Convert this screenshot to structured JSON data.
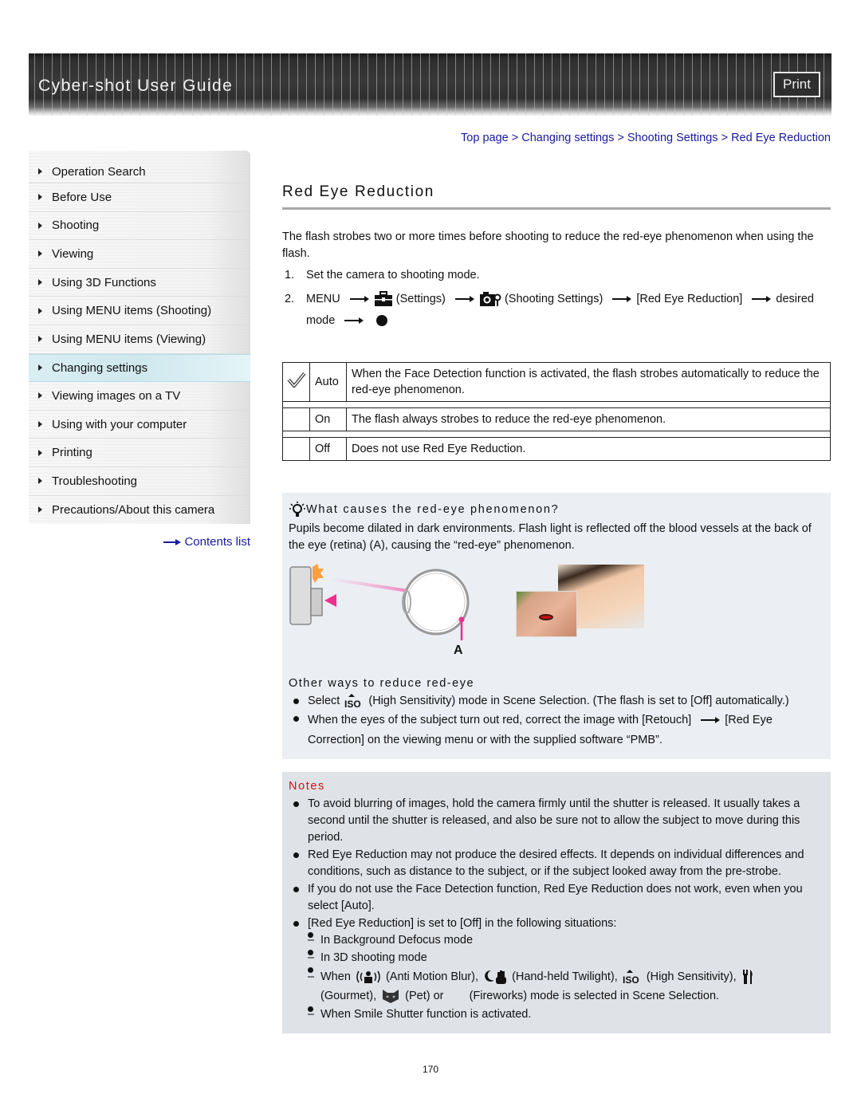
{
  "header": {
    "title": "Cyber-shot User Guide",
    "print_label": "Print"
  },
  "sidebar": {
    "items": [
      {
        "label": "Operation Search"
      },
      {
        "label": "Before Use"
      },
      {
        "label": "Shooting"
      },
      {
        "label": "Viewing"
      },
      {
        "label": "Using 3D Functions"
      },
      {
        "label": "Using MENU items (Shooting)"
      },
      {
        "label": "Using MENU items (Viewing)"
      },
      {
        "label": "Changing settings",
        "active": true
      },
      {
        "label": "Viewing images on a TV"
      },
      {
        "label": "Using with your computer"
      },
      {
        "label": "Printing"
      },
      {
        "label": "Troubleshooting"
      },
      {
        "label": "Precautions/About this camera"
      }
    ],
    "contents_link": "Contents list"
  },
  "breadcrumb": {
    "items": [
      "Top page",
      "Changing settings",
      "Shooting Settings",
      "Red Eye Reduction"
    ],
    "separator": ">"
  },
  "page": {
    "title": "Red Eye Reduction",
    "intro": "The flash strobes two or more times before shooting to reduce the red-eye phenomenon when using the flash.",
    "steps": [
      {
        "num": "1.",
        "text": "Set the camera to shooting mode."
      },
      {
        "num": "2.",
        "parts": {
          "menu": "MENU",
          "settings": "(Settings)",
          "shooting_settings": "(Shooting Settings)",
          "red_eye": "[Red Eye Reduction]",
          "desired": "desired",
          "mode": "mode"
        }
      }
    ],
    "options": [
      {
        "default": true,
        "name": "Auto",
        "desc": "When the Face Detection function is activated, the flash strobes automatically to reduce the red-eye phenomenon."
      },
      {
        "default": false,
        "name": "On",
        "desc": "The flash always strobes to reduce the red-eye phenomenon."
      },
      {
        "default": false,
        "name": "Off",
        "desc": "Does not use Red Eye Reduction."
      }
    ]
  },
  "hint": {
    "title": "What causes the red-eye phenomenon?",
    "text": "Pupils become dilated in dark environments. Flash light is reflected off the blood vessels at the back of the eye (retina) (A), causing the “red-eye” phenomenon.",
    "figure_label": "A",
    "other_title": "Other ways to reduce red-eye",
    "other_items": [
      {
        "pre": "Select",
        "post": "(High Sensitivity) mode in Scene Selection. (The flash is set to [Off] automatically.)"
      },
      {
        "pre": "When the eyes of the subject turn out red, correct the image with [Retouch]",
        "post": "[Red Eye Correction] on the viewing menu or with the supplied software “PMB”."
      }
    ]
  },
  "notes": {
    "title": "Notes",
    "items": [
      "To avoid blurring of images, hold the camera firmly until the shutter is released. It usually takes a second until the shutter is released, and also be sure not to allow the subject to move during this period.",
      "Red Eye Reduction may not produce the desired effects. It depends on individual differences and conditions, such as distance to the subject, or if the subject looked away from the pre-strobe.",
      "If you do not use the Face Detection function, Red Eye Reduction does not work, even when you select [Auto].",
      "[Red Eye Reduction] is set to [Off] in the following situations:"
    ],
    "sub_items": {
      "background_defocus": "In Background Defocus mode",
      "shooting_3d": "In 3D shooting mode",
      "when": "When",
      "anti_motion_blur": "(Anti Motion Blur),",
      "hand_held_twilight": "(Hand-held Twilight),",
      "high_sensitivity": "(High Sensitivity),",
      "gourmet": "(Gourmet),",
      "pet": "(Pet) or",
      "fireworks": "(Fireworks) mode is selected in Scene Selection.",
      "smile_shutter": "When Smile Shutter function is activated."
    }
  },
  "footer": {
    "page_number": "170"
  },
  "colors": {
    "link": "#1a1aa0",
    "notes_title": "#cc1111",
    "hint_bg": "#ebeef3",
    "notes_bg": "#dfe2e7",
    "active_nav": "#d9eef2"
  }
}
